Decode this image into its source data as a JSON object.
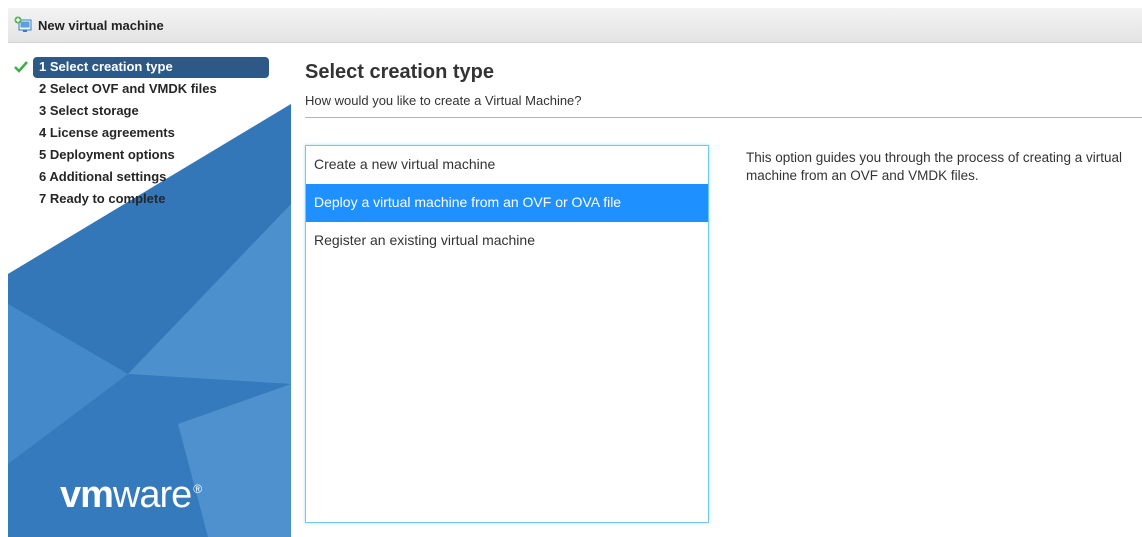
{
  "window": {
    "title": "New virtual machine",
    "icon": "new-vm-icon"
  },
  "wizard": {
    "steps": [
      {
        "label": "1 Select creation type",
        "active": true,
        "completed": true
      },
      {
        "label": "2 Select OVF and VMDK files",
        "active": false,
        "completed": false
      },
      {
        "label": "3 Select storage",
        "active": false,
        "completed": false
      },
      {
        "label": "4 License agreements",
        "active": false,
        "completed": false
      },
      {
        "label": "5 Deployment options",
        "active": false,
        "completed": false
      },
      {
        "label": "6 Additional settings",
        "active": false,
        "completed": false
      },
      {
        "label": "7 Ready to complete",
        "active": false,
        "completed": false
      }
    ],
    "logo": {
      "vm": "vm",
      "ware": "ware",
      "reg": "®"
    }
  },
  "main": {
    "title": "Select creation type",
    "subtitle": "How would you like to create a Virtual Machine?",
    "options": [
      {
        "label": "Create a new virtual machine",
        "selected": false
      },
      {
        "label": "Deploy a virtual machine from an OVF or OVA file",
        "selected": true
      },
      {
        "label": "Register an existing virtual machine",
        "selected": false
      }
    ],
    "description": "This option guides you through the process of creating a virtual machine from an OVF and VMDK files."
  },
  "colors": {
    "accent": "#1e90ff",
    "active_step": "#2e5987",
    "nav_blue": "#3f84c6",
    "check_green": "#3cb043"
  }
}
